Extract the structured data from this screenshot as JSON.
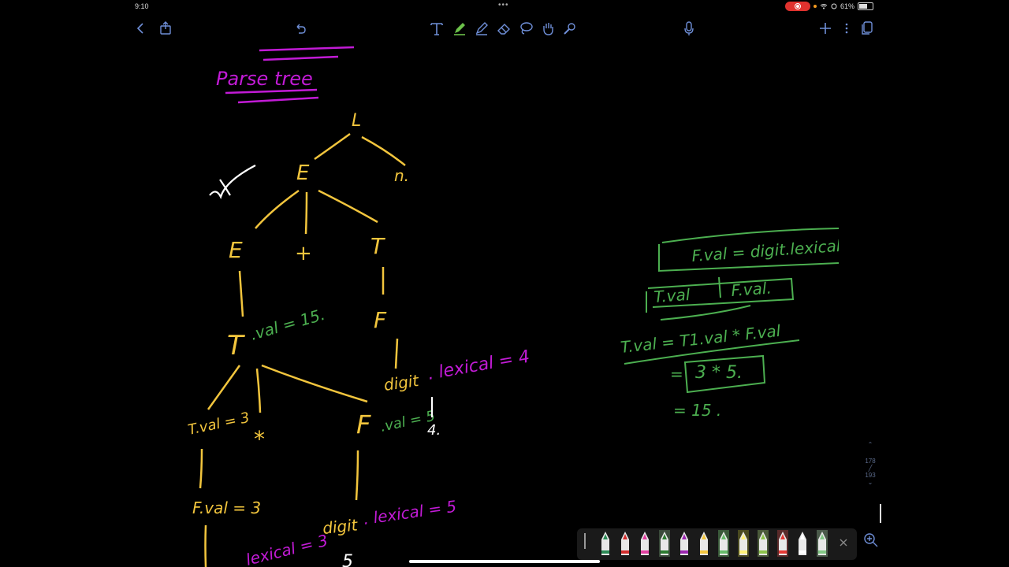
{
  "status": {
    "time": "9:10",
    "battery": "61%"
  },
  "toolbar": {
    "back_icon": "chevron-left-icon",
    "share_icon": "share-icon",
    "undo_icon": "undo-icon",
    "text_tool_icon": "text-tool-icon",
    "pen_icon": "pen-icon",
    "highlighter_icon": "highlighter-icon",
    "eraser_icon": "eraser-icon",
    "lasso_icon": "lasso-icon",
    "shapes_icon": "hand-icon",
    "laser_icon": "laser-pointer-icon",
    "mic_icon": "microphone-icon",
    "add_icon": "plus-icon",
    "more_icon": "more-icon",
    "pages_icon": "pages-icon"
  },
  "notes": {
    "heading": "Parse tree",
    "tree": {
      "root": "L",
      "E_top": "E",
      "n": "n.",
      "E_left": "E",
      "plus": "+",
      "T_right": "T",
      "F_right": "F",
      "T_mid": "T",
      "T_mid_val": ".val = 15.",
      "digit_right": "digit",
      "digit_right_lexical": ". lexical = 4",
      "four": "4.",
      "T_lower": "T.val = 3",
      "star": "*",
      "F_lower": "F",
      "F_lower_val": ".val = 5",
      "F_bottom": "F.val = 3",
      "digit_bottom": "digit",
      "digit_bottom_lexical": ". lexical = 5",
      "lexical_3": "lexical = 3",
      "five": "5"
    },
    "rules": {
      "rule1": "F.val = digit.lexical",
      "rule2_left": "T.val",
      "rule2_right": "F.val.",
      "rule3": "T.val = T1.val * F.val",
      "calc1": "3 * 5.",
      "calc2": "= 15 ."
    },
    "colors": {
      "yellow": "#f2c53d",
      "green": "#4caf50",
      "purple": "#c21bd6",
      "white": "#ffffff"
    }
  },
  "page_indicator": {
    "current": "178",
    "total": "193"
  }
}
